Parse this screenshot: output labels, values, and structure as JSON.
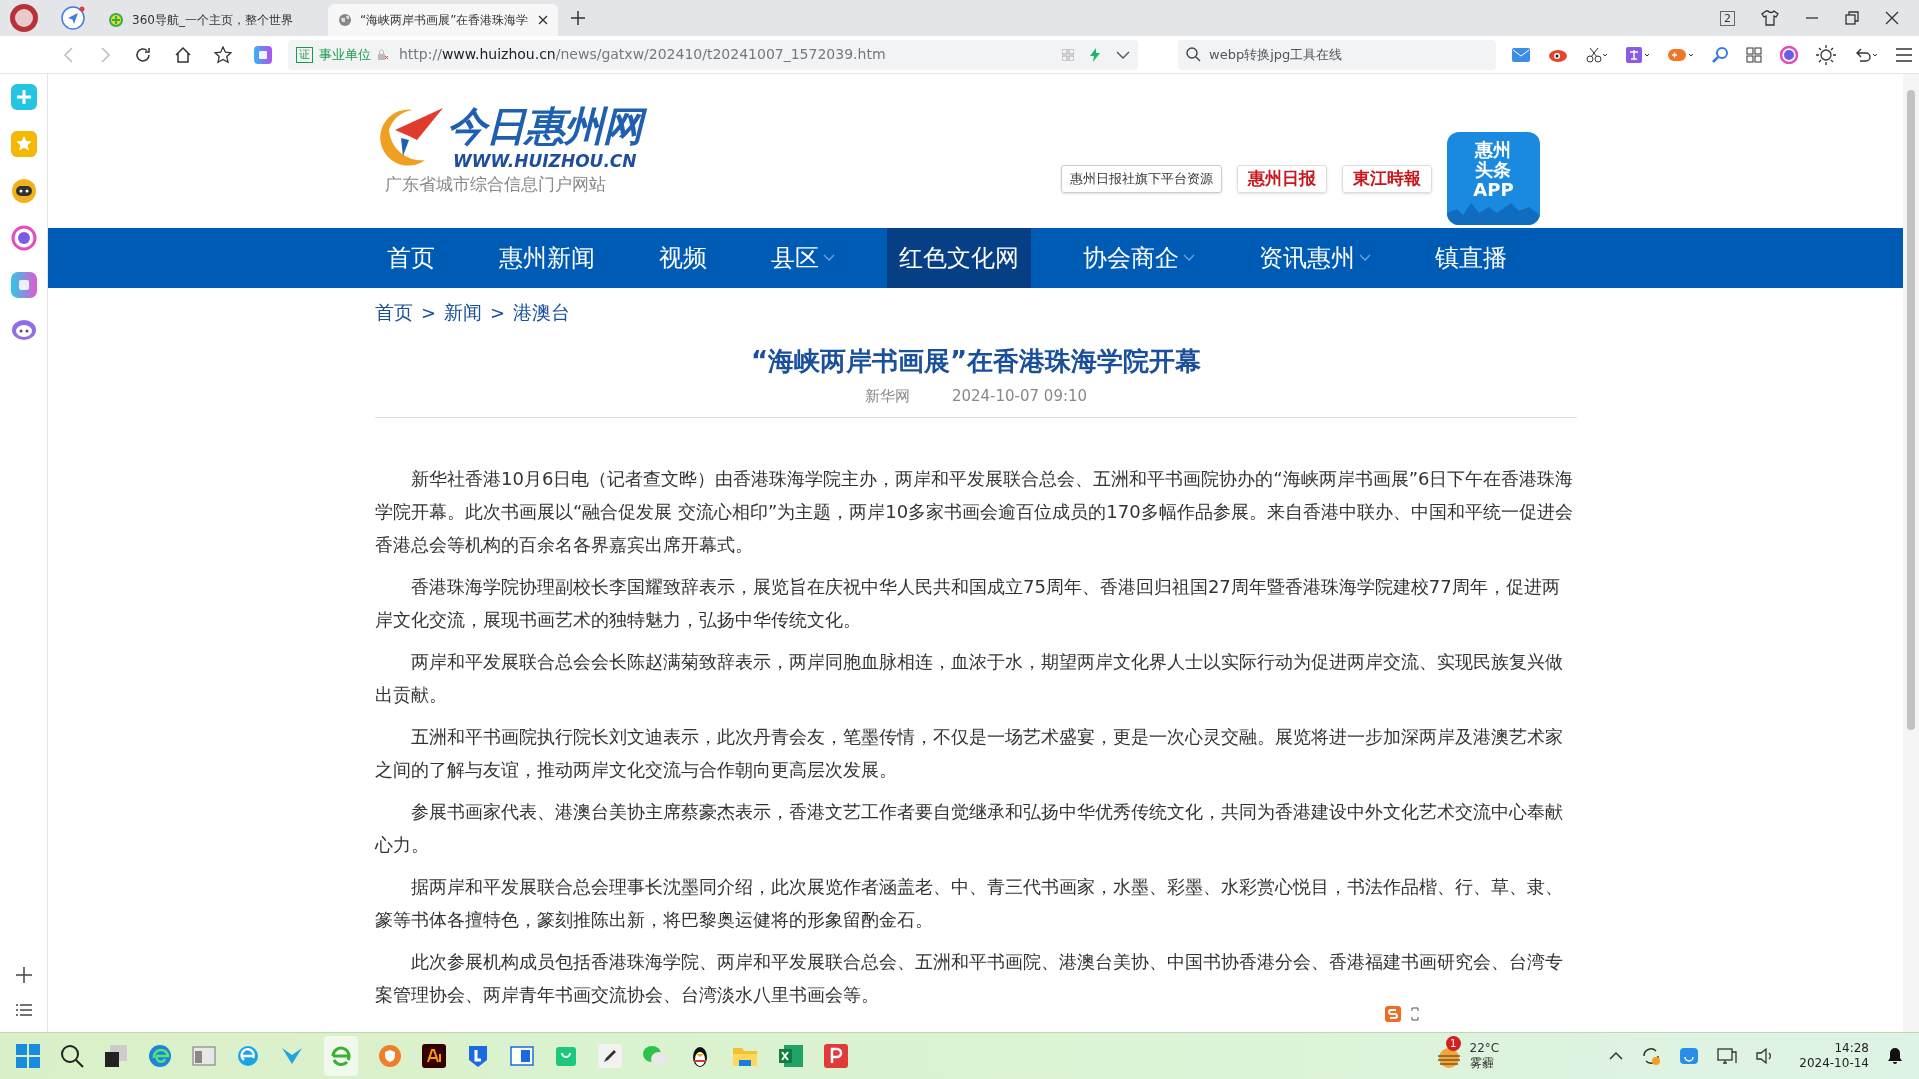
{
  "browser": {
    "tabs": [
      {
        "title": "360导航_一个主页，整个世界",
        "selected": false
      },
      {
        "title": "“海峡两岸书画展”在香港珠海学",
        "selected": true
      }
    ],
    "tab_counter": "2",
    "cert_badge": "证",
    "cert_label": "事业单位",
    "url": {
      "scheme": "http://",
      "domain": "www.huizhou.cn",
      "path": "/news/gatxw/202410/t20241007_1572039.htm"
    },
    "search": {
      "value": "webp转换jpg工具在线"
    }
  },
  "site": {
    "logo_title": "今日惠州网",
    "logo_domain": "WWW.HUIZHOU.CN",
    "tagline": "广东省城市综合信息门户网站",
    "resource_button": "惠州日报社旗下平台资源",
    "papers": [
      "惠州日报",
      "東江時報"
    ],
    "app_tile": [
      "惠州",
      "头条",
      "APP"
    ],
    "nav": [
      {
        "label": "首页",
        "selected": false,
        "dropdown": false
      },
      {
        "label": "惠州新闻",
        "selected": false,
        "dropdown": false
      },
      {
        "label": "视频",
        "selected": false,
        "dropdown": false
      },
      {
        "label": "县区",
        "selected": false,
        "dropdown": true
      },
      {
        "label": "红色文化网",
        "selected": true,
        "dropdown": false
      },
      {
        "label": "协会商企",
        "selected": false,
        "dropdown": true
      },
      {
        "label": "资讯惠州",
        "selected": false,
        "dropdown": true
      },
      {
        "label": "镇直播",
        "selected": false,
        "dropdown": false
      }
    ]
  },
  "breadcrumb": {
    "items": [
      "首页",
      "新闻",
      "港澳台"
    ],
    "separators": [
      ">",
      ">"
    ]
  },
  "article": {
    "title": "“海峡两岸书画展”在香港珠海学院开幕",
    "source": "新华网",
    "date": "2024-10-07 09:10",
    "paragraphs": [
      "新华社香港10月6日电（记者查文晔）由香港珠海学院主办，两岸和平发展联合总会、五洲和平书画院协办的“海峡两岸书画展”6日下午在香港珠海学院开幕。此次书画展以“融合促发展 交流心相印”为主题，两岸10多家书画会逾百位成员的170多幅作品参展。来自香港中联办、中国和平统一促进会香港总会等机构的百余名各界嘉宾出席开幕式。",
      "香港珠海学院协理副校长李国耀致辞表示，展览旨在庆祝中华人民共和国成立75周年、香港回归祖国27周年暨香港珠海学院建校77周年，促进两岸文化交流，展现书画艺术的独特魅力，弘扬中华传统文化。",
      "两岸和平发展联合总会会长陈赵满菊致辞表示，两岸同胞血脉相连，血浓于水，期望两岸文化界人士以实际行动为促进两岸交流、实现民族复兴做出贡献。",
      "五洲和平书画院执行院长刘文迪表示，此次丹青会友，笔墨传情，不仅是一场艺术盛宴，更是一次心灵交融。展览将进一步加深两岸及港澳艺术家之间的了解与友谊，推动两岸文化交流与合作朝向更高层次发展。",
      "参展书画家代表、港澳台美协主席蔡豪杰表示，香港文艺工作者要自觉继承和弘扬中华优秀传统文化，共同为香港建设中外文化艺术交流中心奉献心力。",
      "据两岸和平发展联合总会理事长沈墨同介绍，此次展览作者涵盖老、中、青三代书画家，水墨、彩墨、水彩赏心悦目，书法作品楷、行、草、隶、篆等书体各擅特色，篆刻推陈出新，将巴黎奥运健将的形象留酌金石。",
      "此次参展机构成员包括香港珠海学院、两岸和平发展联合总会、五洲和平书画院、港澳台美协、中国书协香港分会、香港福建书画研究会、台湾专案管理协会、两岸青年书画交流协会、台湾淡水八里书画会等。"
    ]
  },
  "taskbar": {
    "weather_badge": "1",
    "temperature": "22°C",
    "weather": "雾霾",
    "time": "14:28",
    "date": "2024-10-14"
  }
}
